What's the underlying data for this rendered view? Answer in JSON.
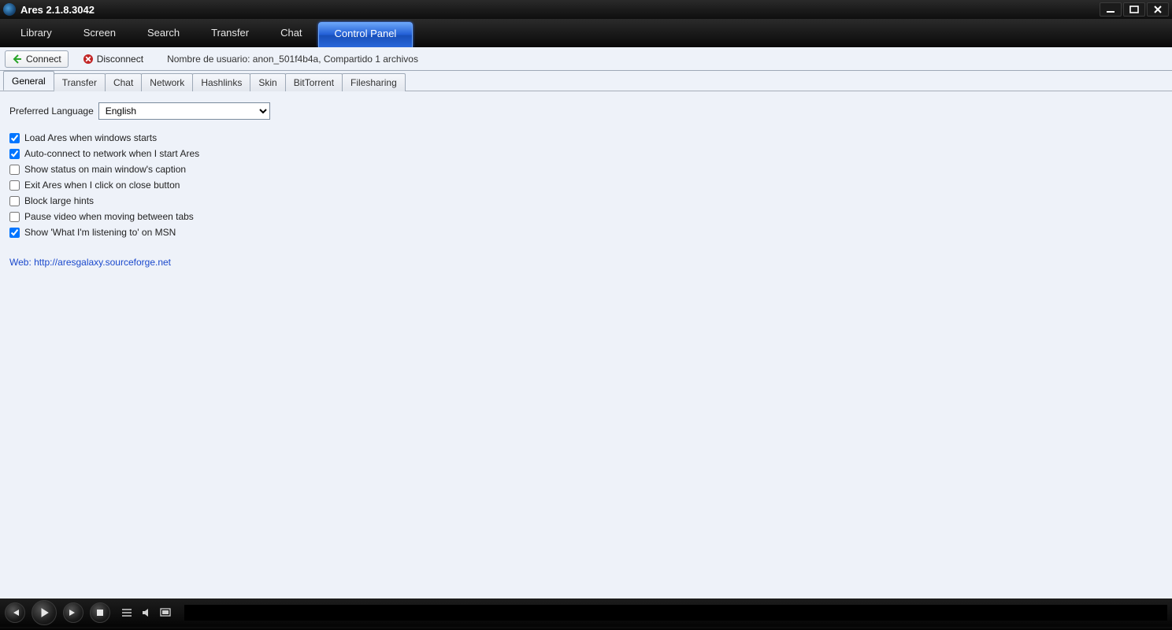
{
  "app": {
    "title": "Ares 2.1.8.3042"
  },
  "nav": {
    "items": [
      {
        "label": "Library"
      },
      {
        "label": "Screen"
      },
      {
        "label": "Search"
      },
      {
        "label": "Transfer"
      },
      {
        "label": "Chat"
      },
      {
        "label": "Control Panel"
      }
    ],
    "active": 5
  },
  "toolbar": {
    "connect": "Connect",
    "disconnect": "Disconnect",
    "status": "Nombre de usuario: anon_501f4b4a, Compartido 1 archivos"
  },
  "tabs": {
    "items": [
      {
        "label": "General"
      },
      {
        "label": "Transfer"
      },
      {
        "label": "Chat"
      },
      {
        "label": "Network"
      },
      {
        "label": "Hashlinks"
      },
      {
        "label": "Skin"
      },
      {
        "label": "BitTorrent"
      },
      {
        "label": "Filesharing"
      }
    ],
    "active": 0
  },
  "general": {
    "preferred_language_label": "Preferred Language",
    "language_value": "English",
    "checks": [
      {
        "label": "Load Ares when windows starts",
        "checked": true
      },
      {
        "label": "Auto-connect to network when I start Ares",
        "checked": true
      },
      {
        "label": "Show status on main window's caption",
        "checked": false
      },
      {
        "label": "Exit Ares when I click on close button",
        "checked": false
      },
      {
        "label": "Block large hints",
        "checked": false
      },
      {
        "label": "Pause video when moving between tabs",
        "checked": false
      },
      {
        "label": "Show 'What I'm listening to' on MSN",
        "checked": true
      }
    ],
    "web_label": "Web: http://aresgalaxy.sourceforge.net"
  }
}
